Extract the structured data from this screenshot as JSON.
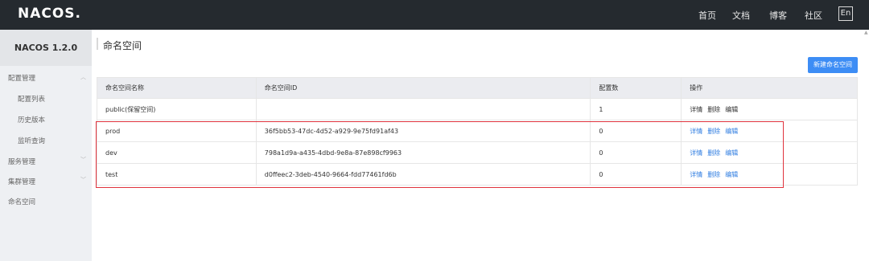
{
  "topbar": {
    "logo": "NACOS.",
    "nav": [
      "首页",
      "文档",
      "博客",
      "社区"
    ],
    "lang": "En"
  },
  "sidebar": {
    "version": "NACOS 1.2.0",
    "items": [
      {
        "label": "配置管理"
      },
      {
        "label": "配置列表"
      },
      {
        "label": "历史版本"
      },
      {
        "label": "监听查询"
      },
      {
        "label": "服务管理"
      },
      {
        "label": "集群管理"
      },
      {
        "label": "命名空间"
      }
    ]
  },
  "main": {
    "title": "命名空间",
    "new_button": "新建命名空间",
    "columns": [
      "命名空间名称",
      "命名空间ID",
      "配置数",
      "操作"
    ],
    "rows": [
      {
        "name": "public(保留空间)",
        "id": "",
        "count": "1",
        "ops": [
          "详情",
          "删除",
          "编辑"
        ]
      },
      {
        "name": "prod",
        "id": "36f5bb53-47dc-4d52-a929-9e75fd91af43",
        "count": "0",
        "ops": [
          "详情",
          "删除",
          "编辑"
        ]
      },
      {
        "name": "dev",
        "id": "798a1d9a-a435-4dbd-9e8a-87e898cf9963",
        "count": "0",
        "ops": [
          "详情",
          "删除",
          "编辑"
        ]
      },
      {
        "name": "test",
        "id": "d0ffeec2-3deb-4540-9664-fdd77461fd6b",
        "count": "0",
        "ops": [
          "详情",
          "删除",
          "编辑"
        ]
      }
    ]
  },
  "colors": {
    "topbar": "#252a2f",
    "sidebar": "#eef0f3",
    "accent": "#3d8df5",
    "link": "#2f7de1",
    "highlight": "#e0333d"
  }
}
